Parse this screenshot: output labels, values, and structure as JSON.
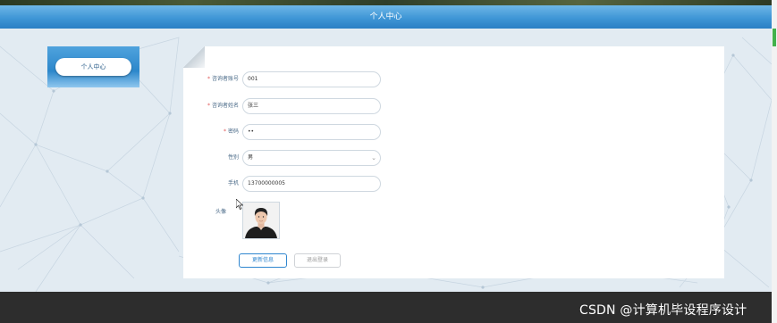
{
  "header": {
    "title": "个人中心"
  },
  "sidebar": {
    "items": [
      {
        "label": "个人中心"
      }
    ]
  },
  "form": {
    "fields": [
      {
        "label": "咨询者账号",
        "required": true,
        "value": "001"
      },
      {
        "label": "咨询者姓名",
        "required": true,
        "value": "张三"
      },
      {
        "label": "密码",
        "required": true,
        "value": "••"
      },
      {
        "label": "性别",
        "required": false,
        "value": "男"
      },
      {
        "label": "手机",
        "required": false,
        "value": "13700000005"
      }
    ],
    "avatar_label": "头像",
    "required_mark": "*",
    "update_button": "更新信息",
    "logout_button": "退出登录"
  },
  "watermark": "CSDN @计算机毕设程序设计",
  "colors": {
    "header": "#3f96d6",
    "accent": "#2f86cf",
    "required": "#e05555",
    "footer": "#2d2d2d"
  },
  "icons": {
    "select_arrow": "chevron-down-icon",
    "cursor": "mouse-cursor-icon"
  }
}
